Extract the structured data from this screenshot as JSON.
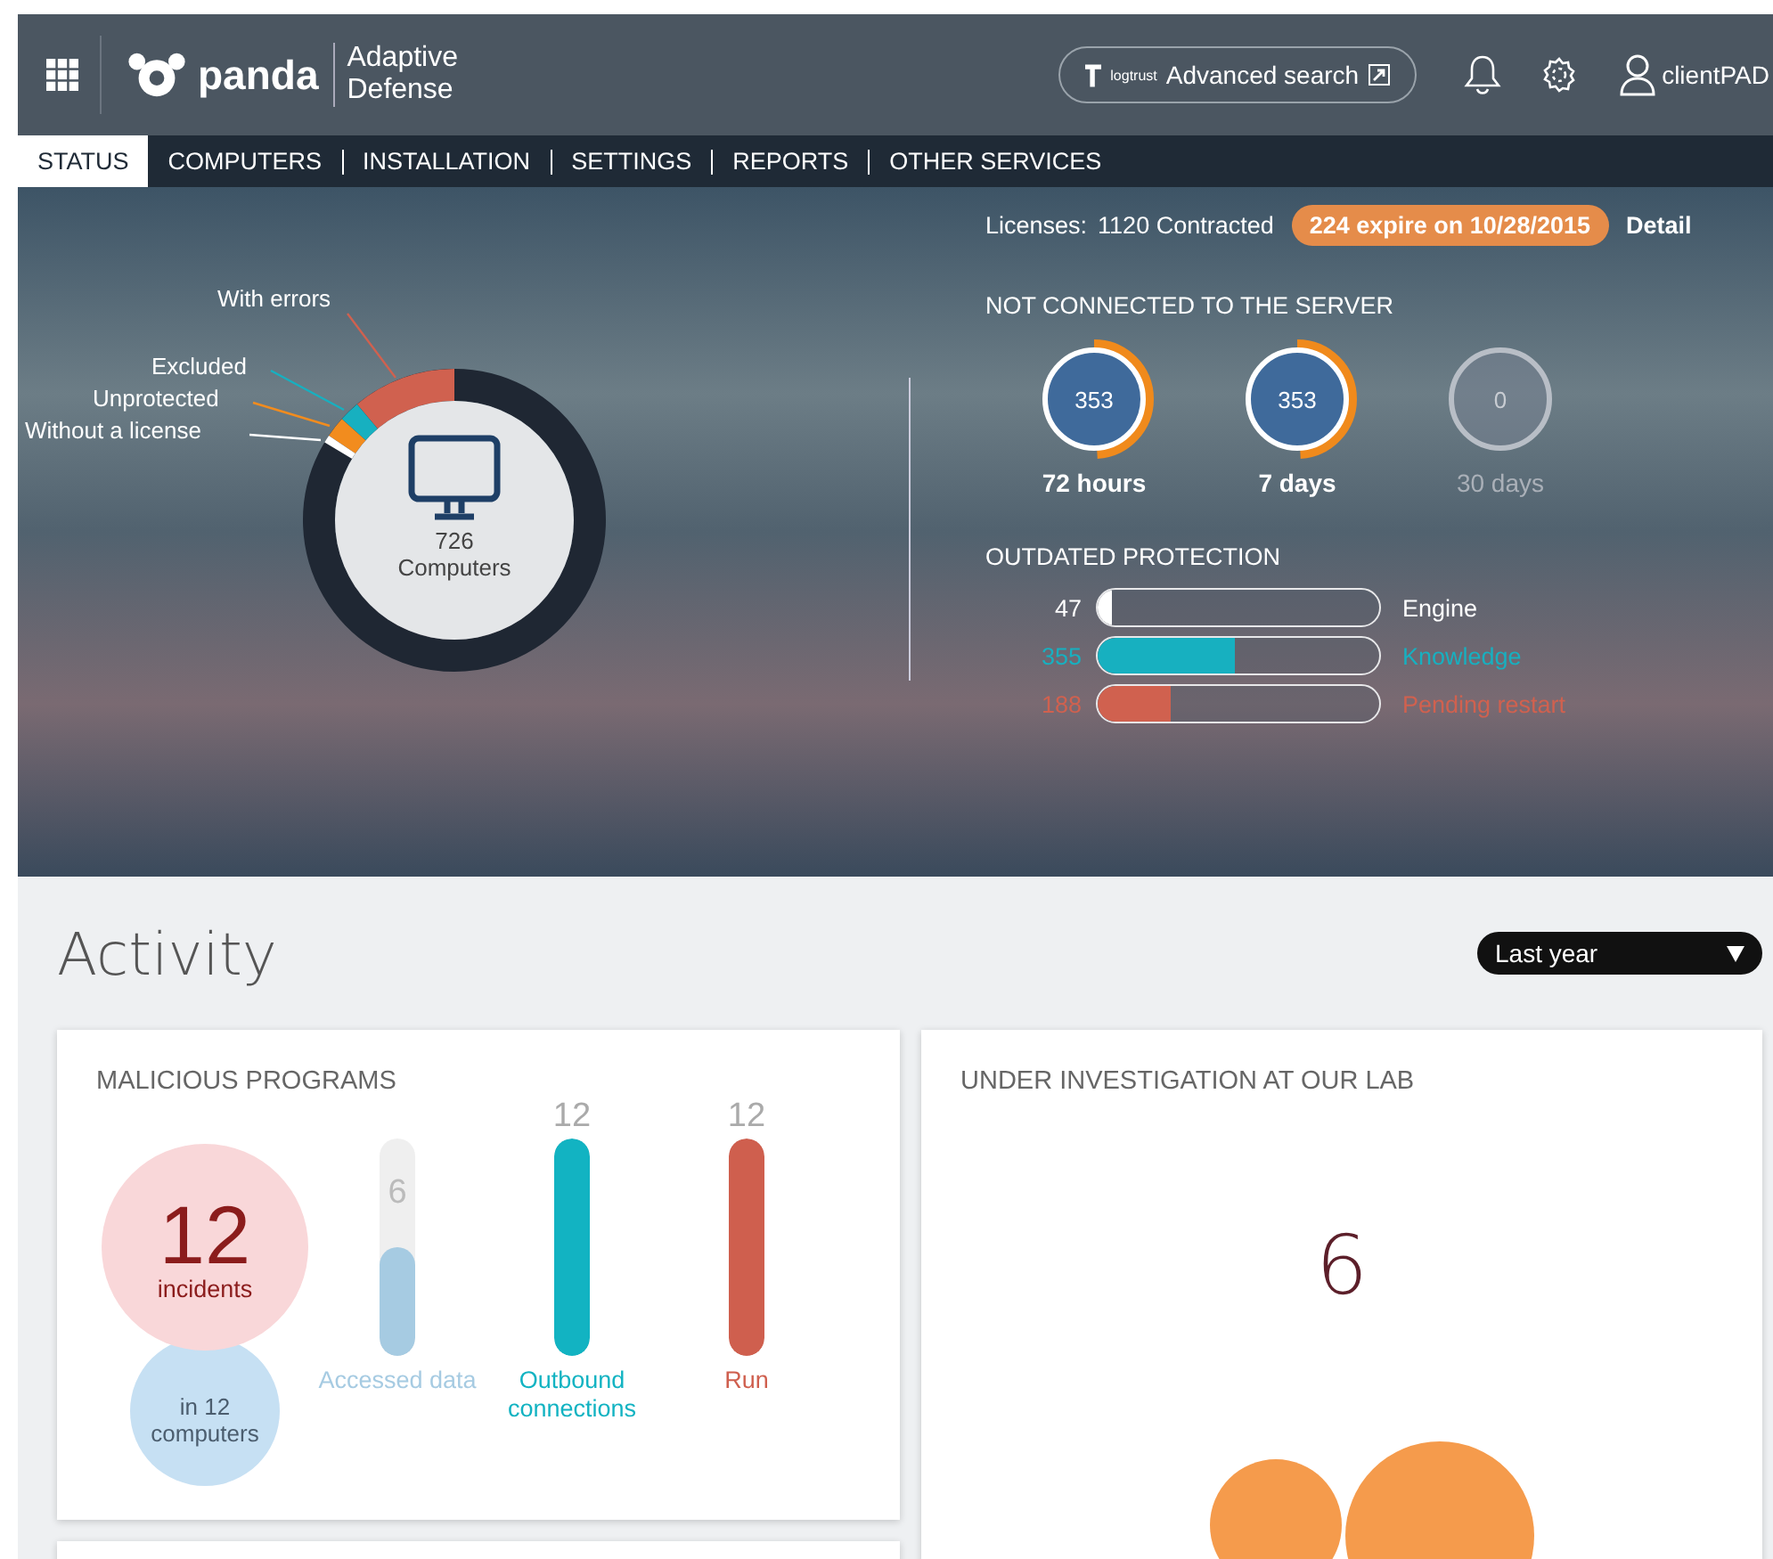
{
  "header": {
    "logo_text": "panda",
    "product": [
      "Adaptive",
      "Defense"
    ],
    "search_button": {
      "brand": "logtrust",
      "label": "Advanced search"
    },
    "user": "clientPAD"
  },
  "tabs": [
    {
      "label": "STATUS",
      "selected": true
    },
    {
      "label": "COMPUTERS",
      "selected": false
    },
    {
      "label": "INSTALLATION",
      "selected": false
    },
    {
      "label": "SETTINGS",
      "selected": false
    },
    {
      "label": "REPORTS",
      "selected": false
    },
    {
      "label": "OTHER SERVICES",
      "selected": false
    }
  ],
  "status": {
    "donut": {
      "count": "726",
      "label": "Computers",
      "segments": [
        {
          "label": "With errors",
          "color": "#d0614f"
        },
        {
          "label": "Excluded",
          "color": "#17b0c0"
        },
        {
          "label": "Unprotected",
          "color": "#f28c1e"
        },
        {
          "label": "Without a license",
          "color": "#ffffff"
        }
      ]
    },
    "licenses": {
      "label": "Licenses:",
      "contracted": "1120 Contracted",
      "expiry_badge": "224 expire on 10/28/2015",
      "details_link": "Detail"
    },
    "not_connected": {
      "title": "NOT CONNECTED TO THE SERVER",
      "items": [
        {
          "value": "353",
          "label": "72 hours",
          "level": 0.49,
          "active": true
        },
        {
          "value": "353",
          "label": "7 days",
          "level": 0.49,
          "active": true
        },
        {
          "value": "0",
          "label": "30 days",
          "level": 0,
          "active": false
        }
      ]
    },
    "outdated": {
      "title": "OUTDATED PROTECTION",
      "items": [
        {
          "value": "47",
          "label": "Engine",
          "level": 0.05,
          "color": "#ffffff"
        },
        {
          "value": "355",
          "label": "Knowledge",
          "level": 0.49,
          "color": "#17b0c0"
        },
        {
          "value": "188",
          "label": "Pending restart",
          "level": 0.26,
          "color": "#d0614f"
        }
      ]
    }
  },
  "activity": {
    "title": "Activity",
    "period": "Last year",
    "malicious": {
      "title": "MALICIOUS PROGRAMS",
      "incidents": "12",
      "incidents_label": "incidents",
      "computers": "in 12 computers",
      "bars": [
        {
          "value": "6",
          "label": "Accessed data",
          "level": 0.5,
          "color": "#a6cbe2"
        },
        {
          "value": "12",
          "label": "Outbound connections",
          "level": 1,
          "color": "#12b3c2"
        },
        {
          "value": "12",
          "label": "Run",
          "level": 1,
          "color": "#cf5f4e"
        }
      ]
    },
    "lab": {
      "title": "UNDER INVESTIGATION AT OUR LAB",
      "count": "6"
    }
  }
}
